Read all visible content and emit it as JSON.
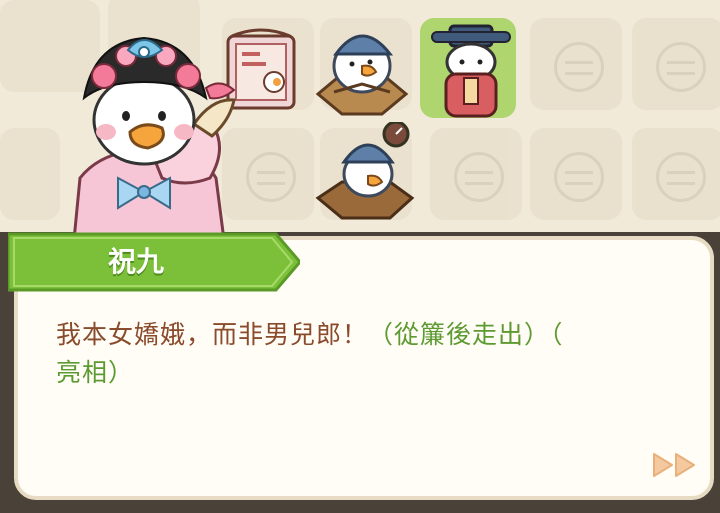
{
  "speaker": {
    "name": "祝九"
  },
  "dialog": {
    "line_main": "我本女嬌娥，而非男兒郎！",
    "line_action_1": "（從簾後走出）",
    "line_action_2a": "（",
    "line_action_2b": "亮相）"
  },
  "icons": {
    "next": "fast-forward-icon",
    "portrait": "opera-duck-portrait",
    "items": [
      "silk-scroll-icon",
      "scholar-duck-reading-icon",
      "official-duck-icon",
      "bundled-scrolls-icon"
    ]
  },
  "colors": {
    "background": "#f1ead8",
    "dialog_text": "#8a4a2c",
    "action_text": "#5e9a32",
    "nametag": "#7cc03a",
    "next_button": "#f5c9a0"
  }
}
